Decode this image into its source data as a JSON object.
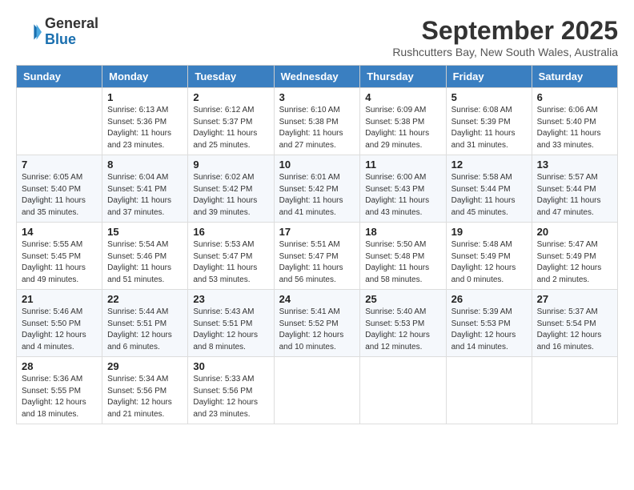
{
  "logo": {
    "line1": "General",
    "line2": "Blue"
  },
  "title": "September 2025",
  "location": "Rushcutters Bay, New South Wales, Australia",
  "days_of_week": [
    "Sunday",
    "Monday",
    "Tuesday",
    "Wednesday",
    "Thursday",
    "Friday",
    "Saturday"
  ],
  "weeks": [
    [
      {
        "day": "",
        "sunrise": "",
        "sunset": "",
        "daylight": ""
      },
      {
        "day": "1",
        "sunrise": "Sunrise: 6:13 AM",
        "sunset": "Sunset: 5:36 PM",
        "daylight": "Daylight: 11 hours and 23 minutes."
      },
      {
        "day": "2",
        "sunrise": "Sunrise: 6:12 AM",
        "sunset": "Sunset: 5:37 PM",
        "daylight": "Daylight: 11 hours and 25 minutes."
      },
      {
        "day": "3",
        "sunrise": "Sunrise: 6:10 AM",
        "sunset": "Sunset: 5:38 PM",
        "daylight": "Daylight: 11 hours and 27 minutes."
      },
      {
        "day": "4",
        "sunrise": "Sunrise: 6:09 AM",
        "sunset": "Sunset: 5:38 PM",
        "daylight": "Daylight: 11 hours and 29 minutes."
      },
      {
        "day": "5",
        "sunrise": "Sunrise: 6:08 AM",
        "sunset": "Sunset: 5:39 PM",
        "daylight": "Daylight: 11 hours and 31 minutes."
      },
      {
        "day": "6",
        "sunrise": "Sunrise: 6:06 AM",
        "sunset": "Sunset: 5:40 PM",
        "daylight": "Daylight: 11 hours and 33 minutes."
      }
    ],
    [
      {
        "day": "7",
        "sunrise": "Sunrise: 6:05 AM",
        "sunset": "Sunset: 5:40 PM",
        "daylight": "Daylight: 11 hours and 35 minutes."
      },
      {
        "day": "8",
        "sunrise": "Sunrise: 6:04 AM",
        "sunset": "Sunset: 5:41 PM",
        "daylight": "Daylight: 11 hours and 37 minutes."
      },
      {
        "day": "9",
        "sunrise": "Sunrise: 6:02 AM",
        "sunset": "Sunset: 5:42 PM",
        "daylight": "Daylight: 11 hours and 39 minutes."
      },
      {
        "day": "10",
        "sunrise": "Sunrise: 6:01 AM",
        "sunset": "Sunset: 5:42 PM",
        "daylight": "Daylight: 11 hours and 41 minutes."
      },
      {
        "day": "11",
        "sunrise": "Sunrise: 6:00 AM",
        "sunset": "Sunset: 5:43 PM",
        "daylight": "Daylight: 11 hours and 43 minutes."
      },
      {
        "day": "12",
        "sunrise": "Sunrise: 5:58 AM",
        "sunset": "Sunset: 5:44 PM",
        "daylight": "Daylight: 11 hours and 45 minutes."
      },
      {
        "day": "13",
        "sunrise": "Sunrise: 5:57 AM",
        "sunset": "Sunset: 5:44 PM",
        "daylight": "Daylight: 11 hours and 47 minutes."
      }
    ],
    [
      {
        "day": "14",
        "sunrise": "Sunrise: 5:55 AM",
        "sunset": "Sunset: 5:45 PM",
        "daylight": "Daylight: 11 hours and 49 minutes."
      },
      {
        "day": "15",
        "sunrise": "Sunrise: 5:54 AM",
        "sunset": "Sunset: 5:46 PM",
        "daylight": "Daylight: 11 hours and 51 minutes."
      },
      {
        "day": "16",
        "sunrise": "Sunrise: 5:53 AM",
        "sunset": "Sunset: 5:47 PM",
        "daylight": "Daylight: 11 hours and 53 minutes."
      },
      {
        "day": "17",
        "sunrise": "Sunrise: 5:51 AM",
        "sunset": "Sunset: 5:47 PM",
        "daylight": "Daylight: 11 hours and 56 minutes."
      },
      {
        "day": "18",
        "sunrise": "Sunrise: 5:50 AM",
        "sunset": "Sunset: 5:48 PM",
        "daylight": "Daylight: 11 hours and 58 minutes."
      },
      {
        "day": "19",
        "sunrise": "Sunrise: 5:48 AM",
        "sunset": "Sunset: 5:49 PM",
        "daylight": "Daylight: 12 hours and 0 minutes."
      },
      {
        "day": "20",
        "sunrise": "Sunrise: 5:47 AM",
        "sunset": "Sunset: 5:49 PM",
        "daylight": "Daylight: 12 hours and 2 minutes."
      }
    ],
    [
      {
        "day": "21",
        "sunrise": "Sunrise: 5:46 AM",
        "sunset": "Sunset: 5:50 PM",
        "daylight": "Daylight: 12 hours and 4 minutes."
      },
      {
        "day": "22",
        "sunrise": "Sunrise: 5:44 AM",
        "sunset": "Sunset: 5:51 PM",
        "daylight": "Daylight: 12 hours and 6 minutes."
      },
      {
        "day": "23",
        "sunrise": "Sunrise: 5:43 AM",
        "sunset": "Sunset: 5:51 PM",
        "daylight": "Daylight: 12 hours and 8 minutes."
      },
      {
        "day": "24",
        "sunrise": "Sunrise: 5:41 AM",
        "sunset": "Sunset: 5:52 PM",
        "daylight": "Daylight: 12 hours and 10 minutes."
      },
      {
        "day": "25",
        "sunrise": "Sunrise: 5:40 AM",
        "sunset": "Sunset: 5:53 PM",
        "daylight": "Daylight: 12 hours and 12 minutes."
      },
      {
        "day": "26",
        "sunrise": "Sunrise: 5:39 AM",
        "sunset": "Sunset: 5:53 PM",
        "daylight": "Daylight: 12 hours and 14 minutes."
      },
      {
        "day": "27",
        "sunrise": "Sunrise: 5:37 AM",
        "sunset": "Sunset: 5:54 PM",
        "daylight": "Daylight: 12 hours and 16 minutes."
      }
    ],
    [
      {
        "day": "28",
        "sunrise": "Sunrise: 5:36 AM",
        "sunset": "Sunset: 5:55 PM",
        "daylight": "Daylight: 12 hours and 18 minutes."
      },
      {
        "day": "29",
        "sunrise": "Sunrise: 5:34 AM",
        "sunset": "Sunset: 5:56 PM",
        "daylight": "Daylight: 12 hours and 21 minutes."
      },
      {
        "day": "30",
        "sunrise": "Sunrise: 5:33 AM",
        "sunset": "Sunset: 5:56 PM",
        "daylight": "Daylight: 12 hours and 23 minutes."
      },
      {
        "day": "",
        "sunrise": "",
        "sunset": "",
        "daylight": ""
      },
      {
        "day": "",
        "sunrise": "",
        "sunset": "",
        "daylight": ""
      },
      {
        "day": "",
        "sunrise": "",
        "sunset": "",
        "daylight": ""
      },
      {
        "day": "",
        "sunrise": "",
        "sunset": "",
        "daylight": ""
      }
    ]
  ]
}
